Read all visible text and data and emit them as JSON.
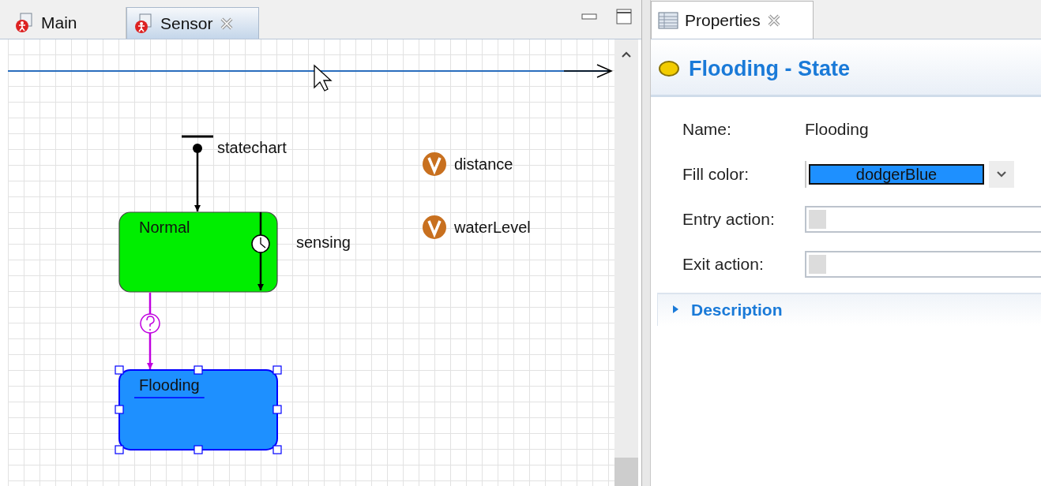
{
  "editor": {
    "tabs": [
      {
        "label": "Main",
        "selected": false,
        "closable": false
      },
      {
        "label": "Sensor",
        "selected": true,
        "closable": true
      }
    ],
    "diagram": {
      "entry_point": {
        "label": "statechart"
      },
      "states": [
        {
          "name": "Normal",
          "color": "#00ee00",
          "selected": false
        },
        {
          "name": "Flooding",
          "color": "#1e90ff",
          "selected": true
        }
      ],
      "transitions": [
        {
          "kind": "timeout",
          "label": "sensing"
        },
        {
          "kind": "condition"
        }
      ],
      "variables": [
        {
          "name": "distance"
        },
        {
          "name": "waterLevel"
        }
      ]
    }
  },
  "properties": {
    "tab": {
      "label": "Properties",
      "selected": true,
      "closable": true
    },
    "title": "Flooding - State",
    "fields": [
      {
        "kind": "text",
        "label": "Name:",
        "value": "Flooding"
      },
      {
        "kind": "color",
        "label": "Fill color:",
        "value": "dodgerBlue",
        "color": "#1e90ff"
      },
      {
        "kind": "code",
        "label": "Entry action:"
      },
      {
        "kind": "code",
        "label": "Exit action:"
      }
    ],
    "section": {
      "label": "Description",
      "expanded": false
    }
  }
}
